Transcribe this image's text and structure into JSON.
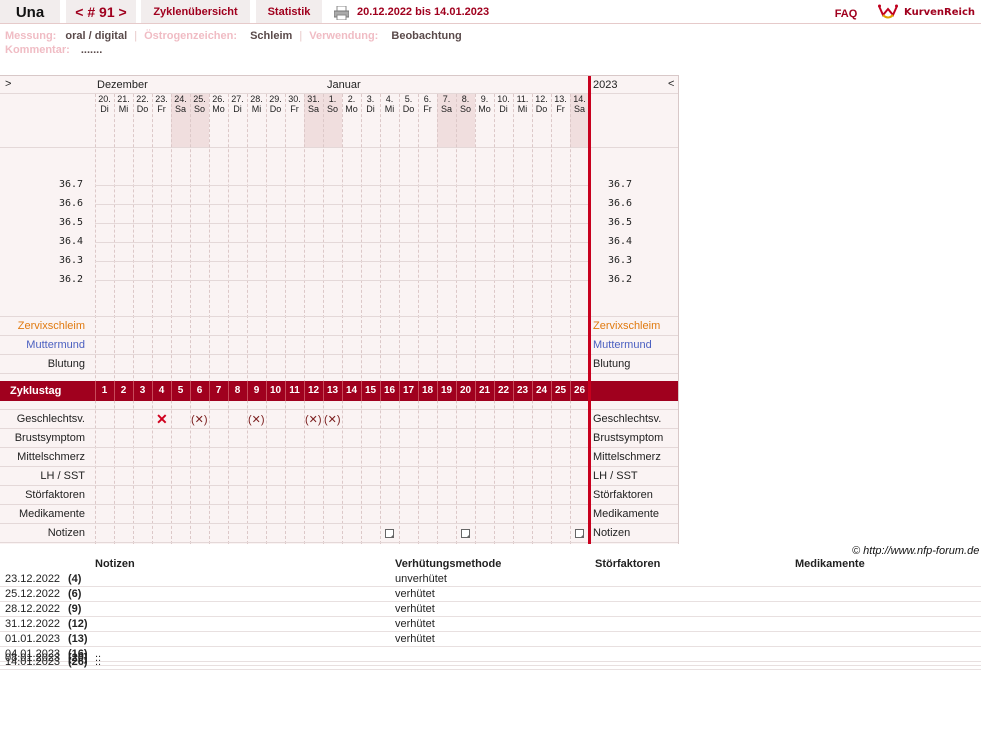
{
  "header": {
    "name": "Una",
    "cycle_nav": "< # 91 >",
    "tab_overview": "Zyklenübersicht",
    "tab_stats": "Statistik",
    "date_range": "20.12.2022 bis 14.01.2023",
    "faq": "FAQ",
    "logo": "KurvenReich"
  },
  "info": {
    "measure_label": "Messung:",
    "measure_value": "oral / digital",
    "estrogen_label": "Östrogenzeichen:",
    "estrogen_value": "Schleim",
    "usage_label": "Verwendung:",
    "usage_value": "Beobachtung",
    "comment_label": "Kommentar:",
    "comment_value": "......."
  },
  "chart": {
    "left_arrow": ">",
    "right_arrow": "<",
    "month1": "Dezember",
    "month2": "Januar",
    "year": "2023",
    "days": [
      {
        "d": "20.",
        "w": "Di"
      },
      {
        "d": "21.",
        "w": "Mi"
      },
      {
        "d": "22.",
        "w": "Do"
      },
      {
        "d": "23.",
        "w": "Fr"
      },
      {
        "d": "24.",
        "w": "Sa"
      },
      {
        "d": "25.",
        "w": "So"
      },
      {
        "d": "26.",
        "w": "Mo"
      },
      {
        "d": "27.",
        "w": "Di"
      },
      {
        "d": "28.",
        "w": "Mi"
      },
      {
        "d": "29.",
        "w": "Do"
      },
      {
        "d": "30.",
        "w": "Fr"
      },
      {
        "d": "31.",
        "w": "Sa"
      },
      {
        "d": "1.",
        "w": "So"
      },
      {
        "d": "2.",
        "w": "Mo"
      },
      {
        "d": "3.",
        "w": "Di"
      },
      {
        "d": "4.",
        "w": "Mi"
      },
      {
        "d": "5.",
        "w": "Do"
      },
      {
        "d": "6.",
        "w": "Fr"
      },
      {
        "d": "7.",
        "w": "Sa"
      },
      {
        "d": "8.",
        "w": "So"
      },
      {
        "d": "9.",
        "w": "Mo"
      },
      {
        "d": "10.",
        "w": "Di"
      },
      {
        "d": "11.",
        "w": "Mi"
      },
      {
        "d": "12.",
        "w": "Do"
      },
      {
        "d": "13.",
        "w": "Fr"
      },
      {
        "d": "14.",
        "w": "Sa"
      }
    ],
    "temps": [
      "36.7",
      "36.6",
      "36.5",
      "36.4",
      "36.3",
      "36.2"
    ],
    "row_zervix": "Zervixschleim",
    "row_mutter": "Muttermund",
    "row_blutung": "Blutung",
    "cycle_label": "Zyklustag",
    "cycle_days": [
      "1",
      "2",
      "3",
      "4",
      "5",
      "6",
      "7",
      "8",
      "9",
      "10",
      "11",
      "12",
      "13",
      "14",
      "15",
      "16",
      "17",
      "18",
      "19",
      "20",
      "21",
      "22",
      "23",
      "24",
      "25",
      "26"
    ],
    "rows_lower": [
      "Geschlechtsv.",
      "Brustsymptom",
      "Mittelschmerz",
      "LH / SST",
      "Störfaktoren",
      "Medikamente",
      "Notizen"
    ],
    "sex_marks": [
      {
        "day": 4,
        "type": "x"
      },
      {
        "day": 6,
        "type": "(x)"
      },
      {
        "day": 9,
        "type": "(x)"
      },
      {
        "day": 12,
        "type": "(x)"
      },
      {
        "day": 13,
        "type": "(x)"
      }
    ],
    "note_days": [
      16,
      20,
      26
    ],
    "copyright": "© http://www.nfp-forum.de"
  },
  "notes": {
    "col_notes": "Notizen",
    "col_method": "Verhütungsmethode",
    "col_stoer": "Störfaktoren",
    "col_med": "Medikamente",
    "rows": [
      {
        "date": "23.12.2022",
        "day": "(4)",
        "method": "unverhütet"
      },
      {
        "date": "25.12.2022",
        "day": "(6)",
        "method": "verhütet"
      },
      {
        "date": "28.12.2022",
        "day": "(9)",
        "method": "verhütet"
      },
      {
        "date": "31.12.2022",
        "day": "(12)",
        "method": "verhütet"
      },
      {
        "date": "01.01.2023",
        "day": "(13)",
        "method": "verhütet"
      }
    ],
    "overlap": [
      {
        "date": "04.01.2023",
        "day": "(16)",
        "note": ".."
      },
      {
        "date": "08.01.2023",
        "day": "(20)",
        "note": ".."
      },
      {
        "date": "14.01.2023",
        "day": "(26)",
        "note": ".."
      }
    ]
  }
}
